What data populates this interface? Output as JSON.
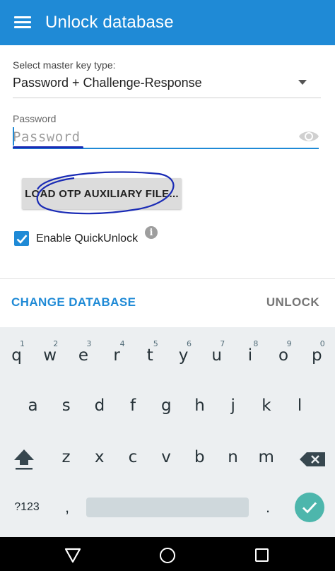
{
  "appbar": {
    "title": "Unlock database",
    "menu_icon": "hamburger-menu-icon",
    "background": "#1f8ad6"
  },
  "key_type": {
    "label": "Select master key type:",
    "selected": "Password + Challenge-Response"
  },
  "password": {
    "label": "Password",
    "placeholder": "Password",
    "value": "",
    "accent": "#1f8ad6"
  },
  "otp_button": {
    "label": "LOAD OTP AUXILIARY FILE..."
  },
  "quick_unlock": {
    "label": "Enable QuickUnlock",
    "checked": true
  },
  "actions": {
    "change_database": "CHANGE DATABASE",
    "unlock": "UNLOCK"
  },
  "keyboard": {
    "row1": [
      {
        "key": "q",
        "hint": "1"
      },
      {
        "key": "w",
        "hint": "2"
      },
      {
        "key": "e",
        "hint": "3"
      },
      {
        "key": "r",
        "hint": "4"
      },
      {
        "key": "t",
        "hint": "5"
      },
      {
        "key": "y",
        "hint": "6"
      },
      {
        "key": "u",
        "hint": "7"
      },
      {
        "key": "i",
        "hint": "8"
      },
      {
        "key": "o",
        "hint": "9"
      },
      {
        "key": "p",
        "hint": "0"
      }
    ],
    "row2": [
      "a",
      "s",
      "d",
      "f",
      "g",
      "h",
      "j",
      "k",
      "l"
    ],
    "row3": [
      "z",
      "x",
      "c",
      "v",
      "b",
      "n",
      "m"
    ],
    "symbols_label": "?123",
    "comma": ",",
    "period": ".",
    "enter_color": "#4db6ac"
  }
}
